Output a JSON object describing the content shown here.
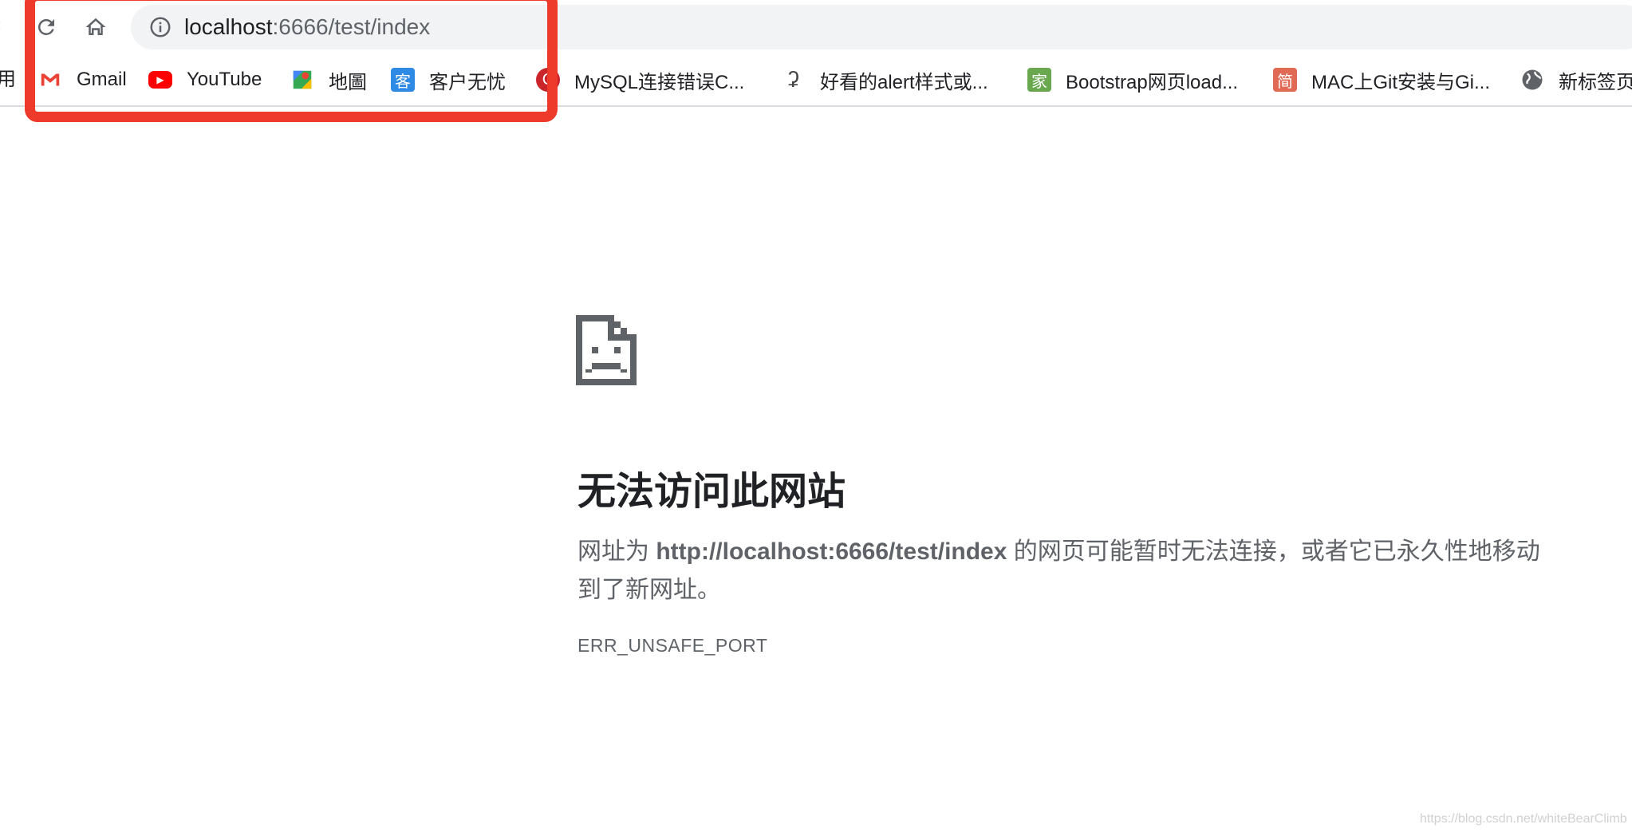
{
  "toolbar": {
    "url_host": "localhost",
    "url_rest": ":6666/test/index"
  },
  "bookmarks": {
    "clipped_left": "用",
    "items": [
      {
        "label": "Gmail",
        "icon": "gmail-icon",
        "color": "#ea4335",
        "glyph": "M"
      },
      {
        "label": "YouTube",
        "icon": "youtube-icon",
        "color": "#ff0000",
        "glyph": "▶"
      },
      {
        "label": "地圖",
        "icon": "maps-icon",
        "color": "#34a853",
        "glyph": ""
      },
      {
        "label": "客户无忧",
        "icon": "kehu-icon",
        "color": "#2f8ae5",
        "glyph": "客"
      },
      {
        "label": "MySQL连接错误C...",
        "icon": "csdn-icon",
        "color": "#c9252b",
        "glyph": "C"
      },
      {
        "label": "好看的alert样式或...",
        "icon": "script-icon",
        "color": "#444444",
        "glyph": "ʡ"
      },
      {
        "label": "Bootstrap网页load...",
        "icon": "jia-icon",
        "color": "#6aa84f",
        "glyph": "家"
      },
      {
        "label": "MAC上Git安装与Gi...",
        "icon": "jianshu-icon",
        "color": "#e06a54",
        "glyph": "简"
      },
      {
        "label": "新标签页",
        "icon": "globe-icon",
        "color": "#5f6368",
        "glyph": "🌐"
      }
    ]
  },
  "error": {
    "title": "无法访问此网站",
    "desc_prefix": "网址为 ",
    "desc_url": "http://localhost:6666/test/index",
    "desc_suffix": " 的网页可能暂时无法连接，或者它已永久性地移动到了新网址。",
    "code": "ERR_UNSAFE_PORT"
  },
  "watermark": "https://blog.csdn.net/whiteBearClimb",
  "colors": {
    "highlight": "#ee3a2a",
    "omnibox_bg": "#f1f3f4",
    "text_secondary": "#5f6368"
  }
}
